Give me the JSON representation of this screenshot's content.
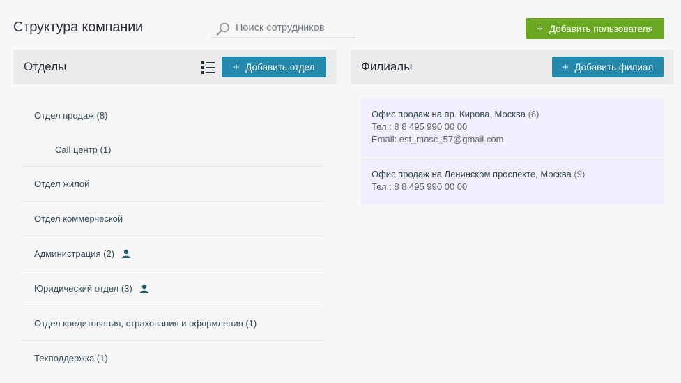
{
  "header": {
    "title": "Структура компании",
    "search_placeholder": "Поиск сотрудников",
    "add_user_label": "Добавить пользователя",
    "plus": "+"
  },
  "departments": {
    "title": "Отделы",
    "add_label": "Добавить отдел",
    "items": [
      {
        "label": "Отдел продаж (8)"
      },
      {
        "label": "Call центр (1)"
      },
      {
        "label": "Отдел жилой"
      },
      {
        "label": "Отдел коммерческой"
      },
      {
        "label": "Администрация (2)"
      },
      {
        "label": "Юридический отдел (3)"
      },
      {
        "label": "Отдел кредитования, страхования и оформления (1)"
      },
      {
        "label": "Техподдержка (1)"
      }
    ]
  },
  "branches": {
    "title": "Филиалы",
    "add_label": "Добавить филиал",
    "items": [
      {
        "name": "Офис продаж на пр. Кирова, Москва",
        "count": "(6)",
        "phone": "Тел.: 8 8 495 990 00 00",
        "email": "Email: est_mosc_57@gmail.com"
      },
      {
        "name": "Офис продаж на Ленинском проспекте, Москва",
        "count": "(9)",
        "phone": "Тел.: 8 8 495 990 00 00"
      }
    ]
  },
  "colors": {
    "green_button": "#6aa824",
    "blue_button": "#2589ad",
    "panel_header": "#ececec",
    "branch_card": "#f3eefc",
    "person_icon": "#1f5a6e"
  }
}
